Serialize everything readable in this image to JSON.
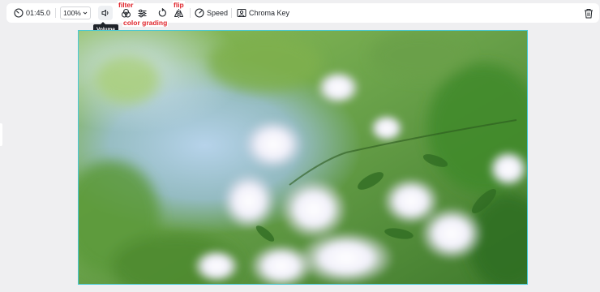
{
  "toolbar": {
    "duration": "01:45.0",
    "zoom": "100%",
    "speed_label": "Speed",
    "chroma_key_label": "Chroma Key",
    "tooltip": "Volume"
  },
  "annotations": {
    "filter": "filter",
    "color_grading": "color grading",
    "flip": "flip"
  },
  "icons": [
    "clock-icon",
    "chevron-down-icon",
    "volume-icon",
    "filter-icon",
    "color-grading-icon",
    "rotate-icon",
    "flip-icon",
    "speed-icon",
    "chroma-key-icon",
    "trash-icon"
  ],
  "colors": {
    "canvas_border": "#46c9d6",
    "annotation": "#e0242b",
    "tooltip_bg": "#1f2329"
  }
}
